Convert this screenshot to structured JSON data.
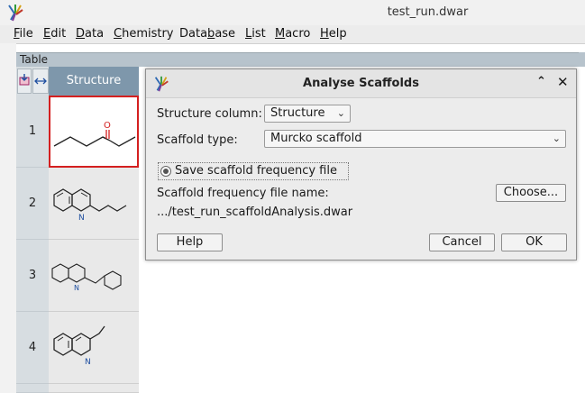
{
  "window": {
    "title": "test_run.dwar"
  },
  "menu": [
    {
      "key": "F",
      "rest": "ile"
    },
    {
      "key": "E",
      "rest": "dit"
    },
    {
      "key": "D",
      "rest": "ata"
    },
    {
      "key": "C",
      "rest": "hemistry"
    },
    {
      "pre": "Data",
      "key": "b",
      "rest": "ase"
    },
    {
      "key": "L",
      "rest": "ist"
    },
    {
      "key": "M",
      "rest": "acro"
    },
    {
      "key": "H",
      "rest": "elp"
    }
  ],
  "table": {
    "label": "Table",
    "column_header": "Structure",
    "rows": [
      "1",
      "2",
      "3",
      "4"
    ]
  },
  "dialog": {
    "title": "Analyse Scaffolds",
    "structure_column_label": "Structure column:",
    "structure_column_value": "Structure",
    "scaffold_type_label": "Scaffold type:",
    "scaffold_type_value": "Murcko scaffold",
    "save_checkbox_label": "Save scaffold frequency file",
    "file_name_label": "Scaffold frequency file name:",
    "choose_button": "Choose...",
    "file_path": ".../test_run_scaffoldAnalysis.dwar",
    "help_button": "Help",
    "cancel_button": "Cancel",
    "ok_button": "OK"
  },
  "icons": {
    "app": "app-logo-icon",
    "maximize": "chevron-up-icon",
    "close": "close-icon"
  },
  "colors": {
    "column_header_bg": "#7e97ab",
    "selected_cell_border": "#d42020"
  }
}
